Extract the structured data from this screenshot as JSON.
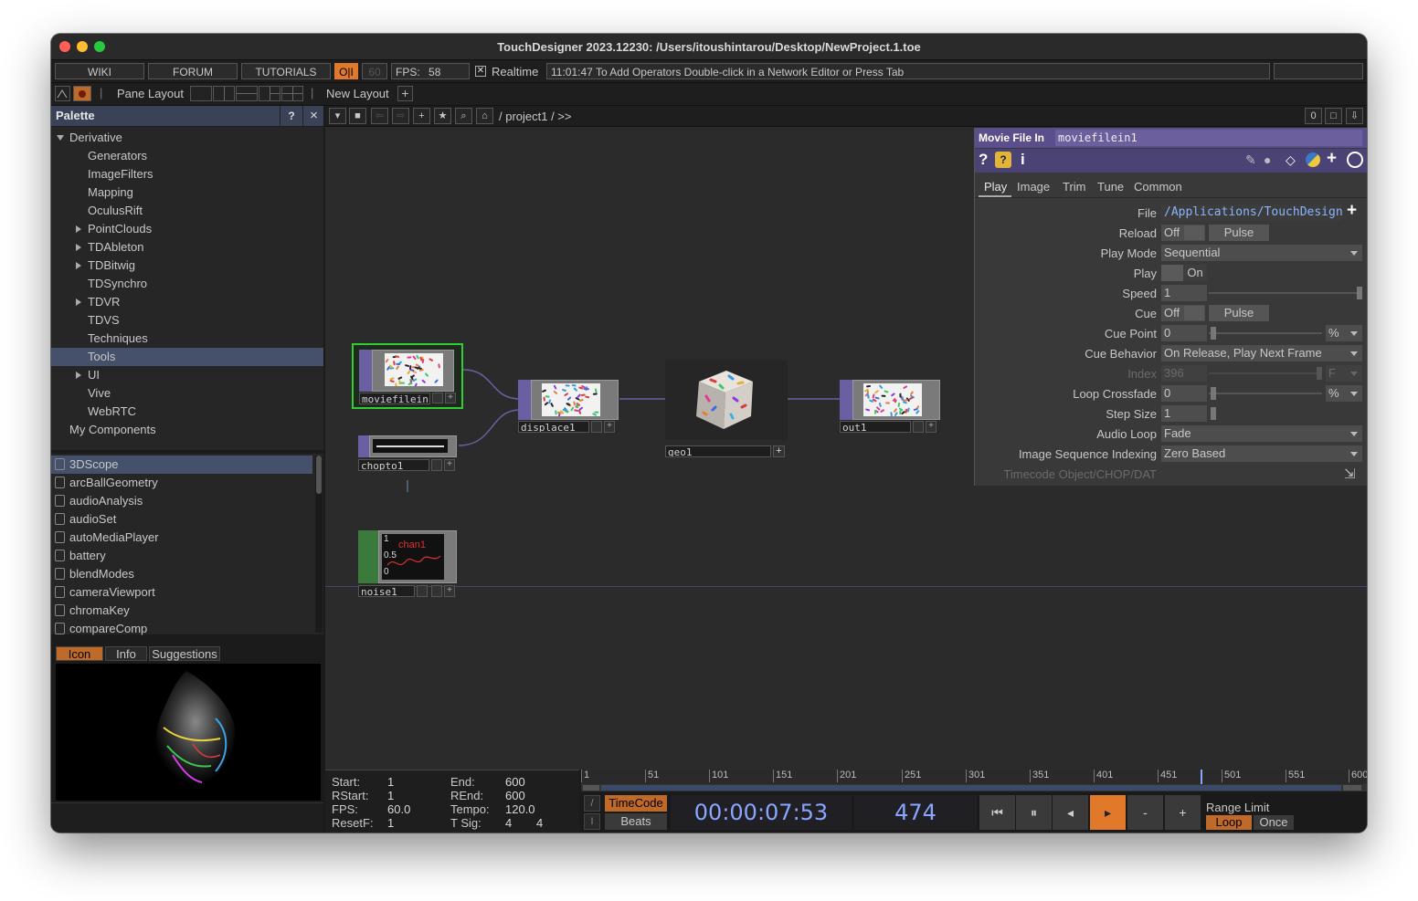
{
  "window": {
    "title": "TouchDesigner 2023.12230: /Users/itoushintarou/Desktop/NewProject.1.toe"
  },
  "toolbar": {
    "wiki": "WIKI",
    "forum": "FORUM",
    "tutorials": "TUTORIALS",
    "oi": "O|I",
    "fps_target": "60",
    "fps_label": "FPS:",
    "fps_value": "58",
    "realtime_check": "✕",
    "realtime_label": "Realtime",
    "status_message": "11:01:47 To Add Operators Double-click in a Network Editor or Press Tab",
    "pane_layout": "Pane Layout",
    "new_layout": "New Layout",
    "add": "+"
  },
  "palette": {
    "title": "Palette",
    "help": "?",
    "close": "×",
    "tree": [
      {
        "label": "Derivative",
        "expanded": true,
        "indent": 0
      },
      {
        "label": "Generators",
        "indent": 1
      },
      {
        "label": "ImageFilters",
        "indent": 1
      },
      {
        "label": "Mapping",
        "indent": 1
      },
      {
        "label": "OculusRift",
        "indent": 1
      },
      {
        "label": "PointClouds",
        "indent": 1,
        "collapsed": true
      },
      {
        "label": "TDAbleton",
        "indent": 1,
        "collapsed": true
      },
      {
        "label": "TDBitwig",
        "indent": 1,
        "collapsed": true
      },
      {
        "label": "TDSynchro",
        "indent": 1
      },
      {
        "label": "TDVR",
        "indent": 1,
        "collapsed": true
      },
      {
        "label": "TDVS",
        "indent": 1
      },
      {
        "label": "Techniques",
        "indent": 1
      },
      {
        "label": "Tools",
        "indent": 1,
        "selected": true
      },
      {
        "label": "UI",
        "indent": 1,
        "collapsed": true
      },
      {
        "label": "Vive",
        "indent": 1
      },
      {
        "label": "WebRTC",
        "indent": 1
      },
      {
        "label": "My Components",
        "indent": 0
      }
    ],
    "components": [
      "3DScope",
      "arcBallGeometry",
      "audioAnalysis",
      "audioSet",
      "autoMediaPlayer",
      "battery",
      "blendModes",
      "cameraViewport",
      "chromaKey",
      "compareComp"
    ],
    "tabs": {
      "icon": "Icon",
      "info": "Info",
      "suggestions": "Suggestions"
    }
  },
  "network": {
    "path": "/ project1 / >>",
    "counter": "0",
    "nodes": {
      "moviefilein": "moviefilein1",
      "displace": "displace1",
      "out": "out1",
      "geo": "geo1",
      "chopto": "chopto1",
      "noise": "noise1",
      "noise_chart_label": "chan1",
      "noise_tick_hi": "1",
      "noise_tick_mid": "0.5",
      "noise_tick_lo": "0"
    }
  },
  "params": {
    "op_type": "Movie File In",
    "op_name": "moviefilein1",
    "tabs": [
      "Play",
      "Image",
      "Trim",
      "Tune",
      "Common"
    ],
    "active_tab": "Play",
    "file_label": "File",
    "file_value": "/Applications/TouchDesign",
    "reload_label": "Reload",
    "reload_value": "Off",
    "reload_pulse": "Pulse",
    "playmode_label": "Play Mode",
    "playmode_value": "Sequential",
    "play_label": "Play",
    "play_value": "On",
    "speed_label": "Speed",
    "speed_value": "1",
    "cue_label": "Cue",
    "cue_value": "Off",
    "cue_pulse": "Pulse",
    "cuepoint_label": "Cue Point",
    "cuepoint_value": "0",
    "cuepoint_unit": "%",
    "cuebehavior_label": "Cue Behavior",
    "cuebehavior_value": "On Release, Play Next Frame",
    "index_label": "Index",
    "index_value": "396",
    "index_unit": "F",
    "loopcrossfade_label": "Loop Crossfade",
    "loopcrossfade_value": "0",
    "loopcrossfade_unit": "%",
    "stepsize_label": "Step Size",
    "stepsize_value": "1",
    "audioloop_label": "Audio Loop",
    "audioloop_value": "Fade",
    "imgseq_label": "Image Sequence Indexing",
    "imgseq_value": "Zero Based",
    "timecode_label": "Timecode Object/CHOP/DAT"
  },
  "timeline": {
    "start_label": "Start:",
    "start": "1",
    "end_label": "End:",
    "end": "600",
    "rstart_label": "RStart:",
    "rstart": "1",
    "rend_label": "REnd:",
    "rend": "600",
    "fps_label": "FPS:",
    "fps": "60.0",
    "tempo_label": "Tempo:",
    "tempo": "120.0",
    "resetf_label": "ResetF:",
    "resetf": "1",
    "tsig_label": "T Sig:",
    "tsig_a": "4",
    "tsig_b": "4",
    "ruler_ticks": [
      "1",
      "51",
      "101",
      "151",
      "201",
      "251",
      "301",
      "351",
      "401",
      "451",
      "501",
      "551",
      "600"
    ],
    "timecode_btn": "TimeCode",
    "beats_btn": "Beats",
    "timecode": "00:00:07:53",
    "frame": "474",
    "range_limit": "Range Limit",
    "loop": "Loop",
    "once": "Once",
    "minus": "-",
    "plus": "+"
  },
  "colors": {
    "accent": "#e07a2a",
    "palette_header": "#3a4257",
    "param_header": "#5a4f8a",
    "selection": "#45506a"
  }
}
